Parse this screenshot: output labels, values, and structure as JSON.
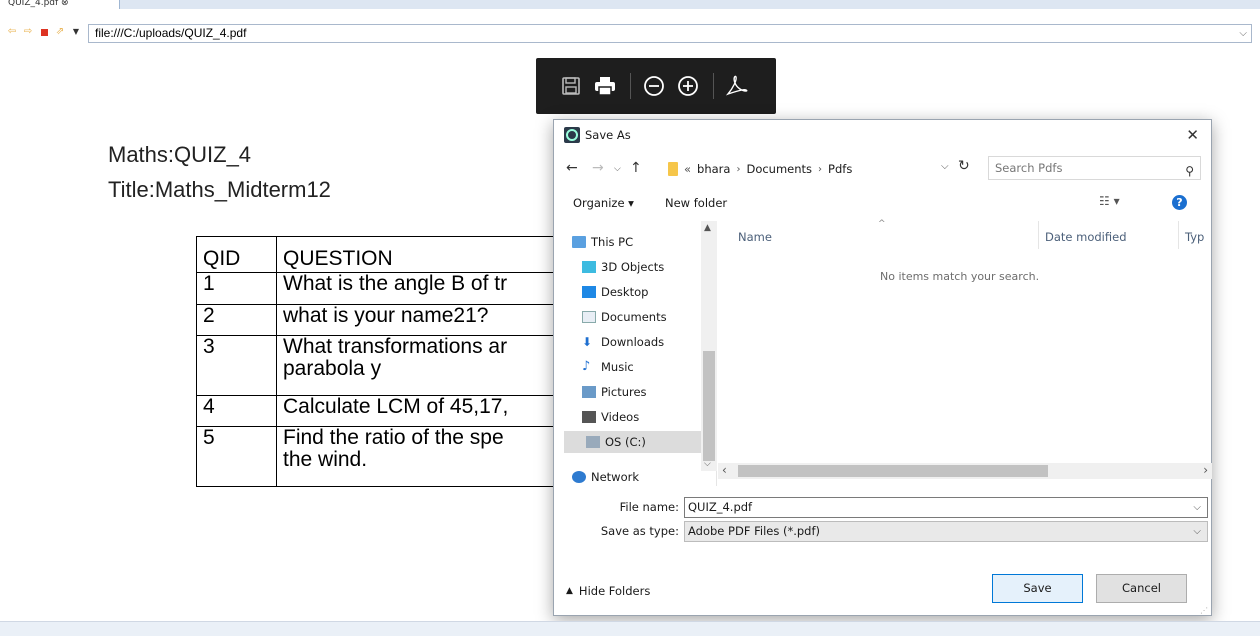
{
  "browser": {
    "tab_title": "QUIZ_4.pdf ⊗",
    "url": "file:///C:/uploads/QUIZ_4.pdf"
  },
  "document": {
    "heading1": "Maths:QUIZ_4",
    "heading2": "Title:Maths_Midterm12",
    "table": {
      "headers": [
        "QID",
        "QUESTION"
      ],
      "rows": [
        {
          "qid": "1",
          "question": "What is the angle B of tr"
        },
        {
          "qid": "2",
          "question": "what is your name21?"
        },
        {
          "qid": "3",
          "question": "What transformations ar",
          "question2": "parabola y"
        },
        {
          "qid": "4",
          "question": "Calculate LCM of 45,17,"
        },
        {
          "qid": "5",
          "question": " Find the ratio of the spe",
          "question2": "the wind."
        }
      ]
    }
  },
  "dialog": {
    "title": "Save As",
    "breadcrumb": [
      "«",
      "bhara",
      "Documents",
      "Pdfs"
    ],
    "search_placeholder": "Search Pdfs",
    "organize": "Organize ▾",
    "new_folder": "New folder",
    "nav_items": [
      "This PC",
      "3D Objects",
      "Desktop",
      "Documents",
      "Downloads",
      "Music",
      "Pictures",
      "Videos",
      "OS (C:)",
      "Network"
    ],
    "columns": [
      "Name",
      "Date modified",
      "Typ"
    ],
    "empty_message": "No items match your search.",
    "file_name_label": "File name:",
    "file_name": "QUIZ_4.pdf",
    "save_type_label": "Save as type:",
    "save_type": "Adobe PDF Files (*.pdf)",
    "hide_folders": "Hide Folders",
    "save_button": "Save",
    "cancel_button": "Cancel"
  }
}
